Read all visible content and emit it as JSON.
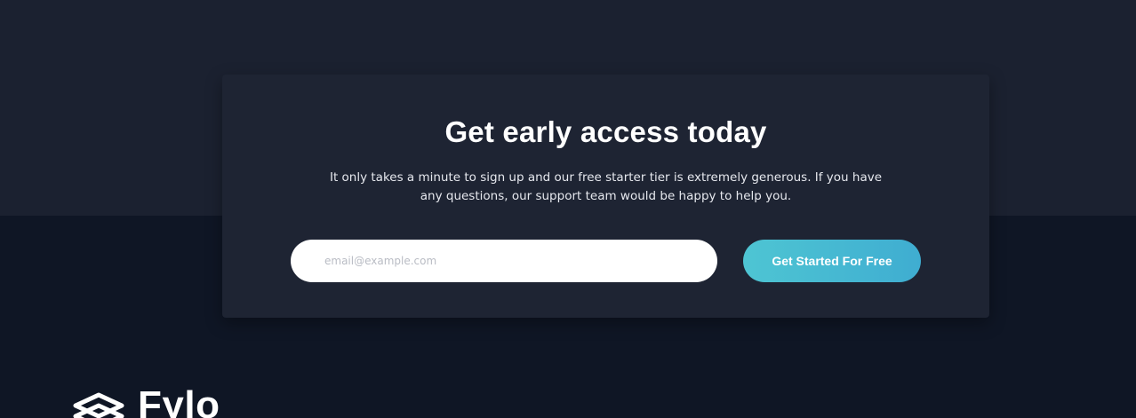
{
  "cta": {
    "title": "Get early access today",
    "description": "It only takes a minute to sign up and our free starter tier is extremely generous. If you have any questions, our support team would be happy to help you.",
    "email_placeholder": "email@example.com",
    "button_label": "Get Started For Free"
  },
  "footer": {
    "brand_name": "Fylo",
    "logo_icon": "stacked-layers-icon"
  },
  "colors": {
    "top_background": "#1b2130",
    "bottom_background": "#0f1625",
    "card_background": "#1e2433",
    "button_gradient_start": "#4ec5d3",
    "button_gradient_end": "#3fadd1",
    "text": "#ffffff"
  }
}
